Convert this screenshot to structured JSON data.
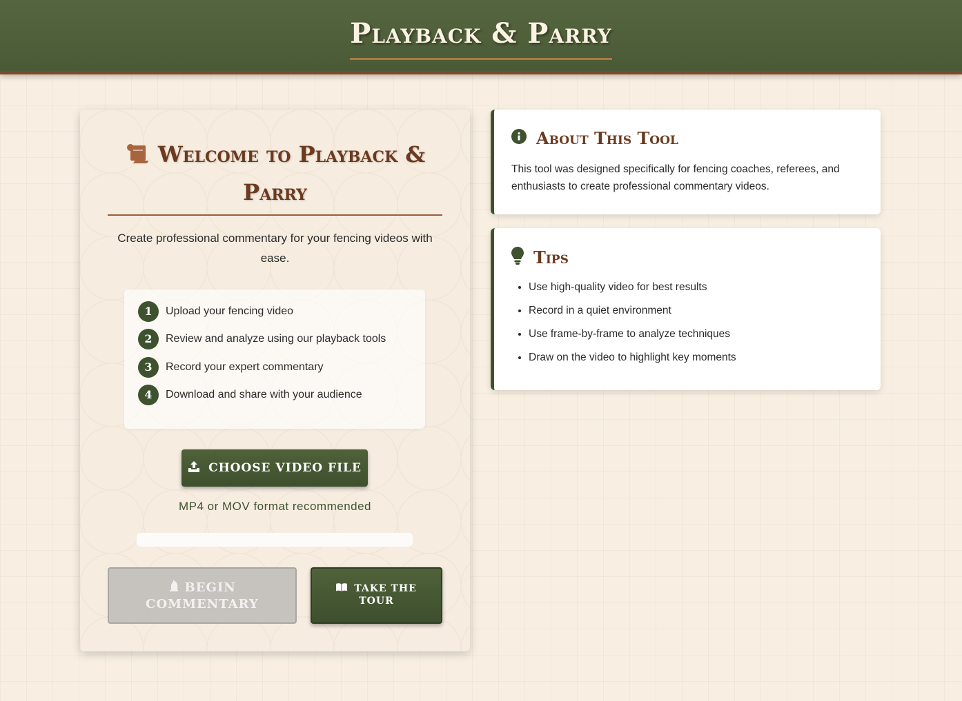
{
  "app": {
    "title": "Playback & Parry"
  },
  "welcome": {
    "title": "Welcome to Playback & Parry",
    "subtitle": "Create professional commentary for your fencing videos with ease."
  },
  "steps": [
    {
      "num": "1",
      "text": "Upload your fencing video"
    },
    {
      "num": "2",
      "text": "Review and analyze using our playback tools"
    },
    {
      "num": "3",
      "text": "Record your expert commentary"
    },
    {
      "num": "4",
      "text": "Download and share with your audience"
    }
  ],
  "upload": {
    "button_label": "CHOOSE VIDEO FILE",
    "format_note": "MP4 or MOV format recommended",
    "progress_percent": 0
  },
  "actions": {
    "begin_line1": "BEGIN",
    "begin_line2": "COMMENTARY",
    "tour_line1": "TAKE THE",
    "tour_line2": "TOUR"
  },
  "about": {
    "title": "About This Tool",
    "text": "This tool was designed specifically for fencing coaches, referees, and enthusiasts to create professional commentary videos."
  },
  "tips": {
    "title": "Tips",
    "items": [
      "Use high-quality video for best results",
      "Record in a quiet environment",
      "Use frame-by-frame to analyze techniques",
      "Draw on the video to highlight key moments"
    ]
  },
  "icons": {
    "welcome": "scroll-icon",
    "upload": "upload-icon",
    "begin": "chess-knight-icon",
    "tour": "book-open-icon",
    "about": "info-circle-icon",
    "tips": "lightbulb-icon"
  },
  "colors": {
    "header_green": "#4a5a37",
    "accent_brown": "#6b3a1f",
    "button_green": "#3e5230",
    "background": "#f8efe2"
  }
}
